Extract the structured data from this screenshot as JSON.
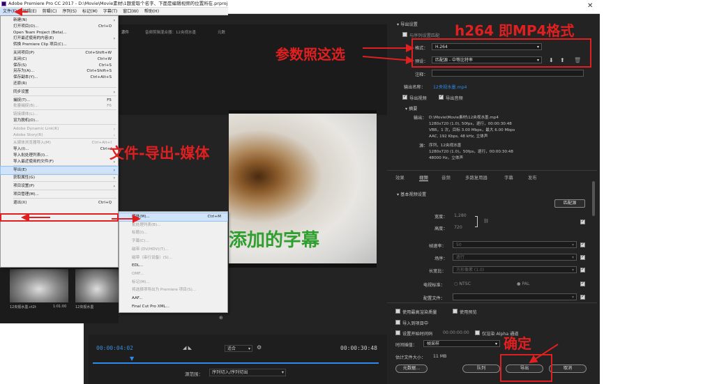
{
  "window": {
    "title": "Adobe Premiere Pro CC 2017 - D:\\Movie\\Movie素材\\1题爱取个名字、下面是编辑视频的位置所在.prproj *",
    "close_icon": "close-icon"
  },
  "menubar": [
    "文件(F)",
    "编辑(E)",
    "剪辑(C)",
    "序列(S)",
    "标记(M)",
    "字幕(T)",
    "窗口(W)",
    "帮助(H)"
  ],
  "file_menu": [
    {
      "label": "新建(N)",
      "arrow": true
    },
    {
      "label": "打开项目(O)...",
      "shortcut": "Ctrl+O"
    },
    {
      "label": "Open Team Project (Beta)..."
    },
    {
      "label": "打开最近使用的内容(E)",
      "arrow": true
    },
    {
      "label": "转换 Premiere Clip 项目(C)..."
    },
    {
      "sep": true
    },
    {
      "label": "关闭项目(P)",
      "shortcut": "Ctrl+Shift+W"
    },
    {
      "label": "关闭(C)",
      "shortcut": "Ctrl+W"
    },
    {
      "label": "保存(S)",
      "shortcut": "Ctrl+S"
    },
    {
      "label": "另存为(A)...",
      "shortcut": "Ctrl+Shift+S"
    },
    {
      "label": "保存副本(Y)...",
      "shortcut": "Ctrl+Alt+S"
    },
    {
      "label": "还原(R)"
    },
    {
      "sep": true
    },
    {
      "label": "同步设置",
      "arrow": true
    },
    {
      "sep": true
    },
    {
      "label": "捕捉(T)...",
      "shortcut": "F5"
    },
    {
      "label": "批量捕捉(B)...",
      "shortcut": "F6",
      "disabled": true
    },
    {
      "sep": true
    },
    {
      "label": "链接媒体(L)...",
      "disabled": true
    },
    {
      "label": "设为脱机(O)..."
    },
    {
      "sep": true
    },
    {
      "label": "Adobe Dynamic Link(K)",
      "arrow": true,
      "disabled": true
    },
    {
      "label": "Adobe Story(R)",
      "arrow": true,
      "disabled": true
    },
    {
      "sep": true
    },
    {
      "label": "从媒体浏览器导入(M)",
      "shortcut": "Ctrl+Alt+I",
      "disabled": true
    },
    {
      "label": "导入(I)...",
      "shortcut": "Ctrl+I"
    },
    {
      "label": "导入批处理列表(I)..."
    },
    {
      "label": "导入最近使用的文件(F)",
      "arrow": true
    },
    {
      "sep": true
    },
    {
      "label": "导出(E)",
      "arrow": true,
      "highlighted": true
    },
    {
      "sep": true
    },
    {
      "label": "获取属性(G)",
      "arrow": true
    },
    {
      "sep": true
    },
    {
      "label": "项目设置(P)",
      "arrow": true
    },
    {
      "sep": true
    },
    {
      "label": "项目管理(M)..."
    },
    {
      "sep": true
    },
    {
      "label": "退出(X)",
      "shortcut": "Ctrl+Q"
    }
  ],
  "export_submenu": [
    {
      "label": "媒体(M)...",
      "shortcut": "Ctrl+M",
      "highlighted": true
    },
    {
      "label": "批处理列表(B)...",
      "disabled": true
    },
    {
      "label": "标题(I)...",
      "disabled": true
    },
    {
      "label": "字幕(C)...",
      "disabled": true
    },
    {
      "label": "磁带 (DV/HDV)(T)...",
      "disabled": true
    },
    {
      "label": "磁带（串行设备）(S)...",
      "disabled": true
    },
    {
      "label": "EDL..."
    },
    {
      "label": "OMF...",
      "disabled": true
    },
    {
      "label": "标记(M)...",
      "disabled": true
    },
    {
      "label": "将选择项导出为 Premiere 项目(S)...",
      "disabled": true
    },
    {
      "label": "AAF..."
    },
    {
      "label": "Final Cut Pro XML..."
    }
  ],
  "annotations": {
    "file_export_media": "文件-导出-媒体",
    "params": "参数照这选",
    "h264": "h264 即MP4格式",
    "confirm": "确定"
  },
  "background_panel": {
    "tabs": [
      "源件",
      "音频剪辑混合器：12央视水墨",
      "元数"
    ],
    "thumbs": [
      {
        "name": "12央视水墨.ct2t",
        "duration": "1:01:00"
      },
      {
        "name": "12央视水墨",
        "duration": ""
      }
    ],
    "subtitle": "添加的字幕"
  },
  "timeline": {
    "current_tc": "00:00:04:02",
    "end_tc": "00:00:30:48",
    "fit": "适合",
    "source_range_label": "源范围：",
    "source_range_value": "序列切入/序列切出"
  },
  "export_settings": {
    "section_title": "导出设置",
    "match_sequence": "与序列设置匹配",
    "format_label": "格式：",
    "format_value": "H.264",
    "preset_label": "预设：",
    "preset_value": "匹配源 - 中等比特率",
    "comment_label": "注释：",
    "output_label": "输出名称：",
    "output_value": "12央视水墨.mp4",
    "export_video": "导出视频",
    "export_audio": "导出音频",
    "summary_title": "摘要",
    "output_key": "输出：",
    "output_lines": [
      "D:\\Movie\\Movie素材\\12央视水墨.mp4",
      "1280x720 (1.0), 50fps，逐行，00:00:30:48",
      "VBR，1 次，目标 3.00 Mbps，最大 6.00 Mbps",
      "AAC, 192 Kbps, 48 kHz, 立体声"
    ],
    "source_key": "源：",
    "source_lines": [
      "序列，12央视水墨",
      "1280x720 (1.0)，50fps，逐行，00:00:30:48",
      "48000 Hz，立体声"
    ],
    "tabs": [
      "效果",
      "视频",
      "音频",
      "多路复用器",
      "字幕",
      "发布"
    ],
    "basic_video": "基本视频设置",
    "match_source_btn": "匹配源",
    "width_label": "宽度：",
    "width_value": "1,280",
    "height_label": "高度：",
    "height_value": "720",
    "fps_label": "帧速率：",
    "fps_value": "50",
    "field_label": "场序：",
    "field_value": "逐行",
    "aspect_label": "长宽比：",
    "aspect_value": "方形像素 (1.0)",
    "tv_label": "电视标准：",
    "tv_ntsc": "NTSC",
    "tv_pal": "PAL",
    "profile_label": "配置文件：",
    "max_depth": "使用最高渲染质量",
    "use_preview": "使用预览",
    "import_project": "导入到项目中",
    "set_start_tc": "设置开始时间码",
    "start_tc": "00:00:00:00",
    "alpha_only": "仅渲染 Alpha 通道",
    "time_interp_label": "时间插值：",
    "time_interp_value": "帧采样",
    "est_size_label": "估计文件大小：",
    "est_size_value": "11 MB",
    "metadata_btn": "元数据...",
    "queue_btn": "队列",
    "export_btn": "导出",
    "cancel_btn": "取消"
  },
  "colors": {
    "annotation_red": "#e02020",
    "subtitle_green": "#2fa02f",
    "timecode_blue": "#3a8fd8",
    "link_blue": "#2d8ceb"
  }
}
